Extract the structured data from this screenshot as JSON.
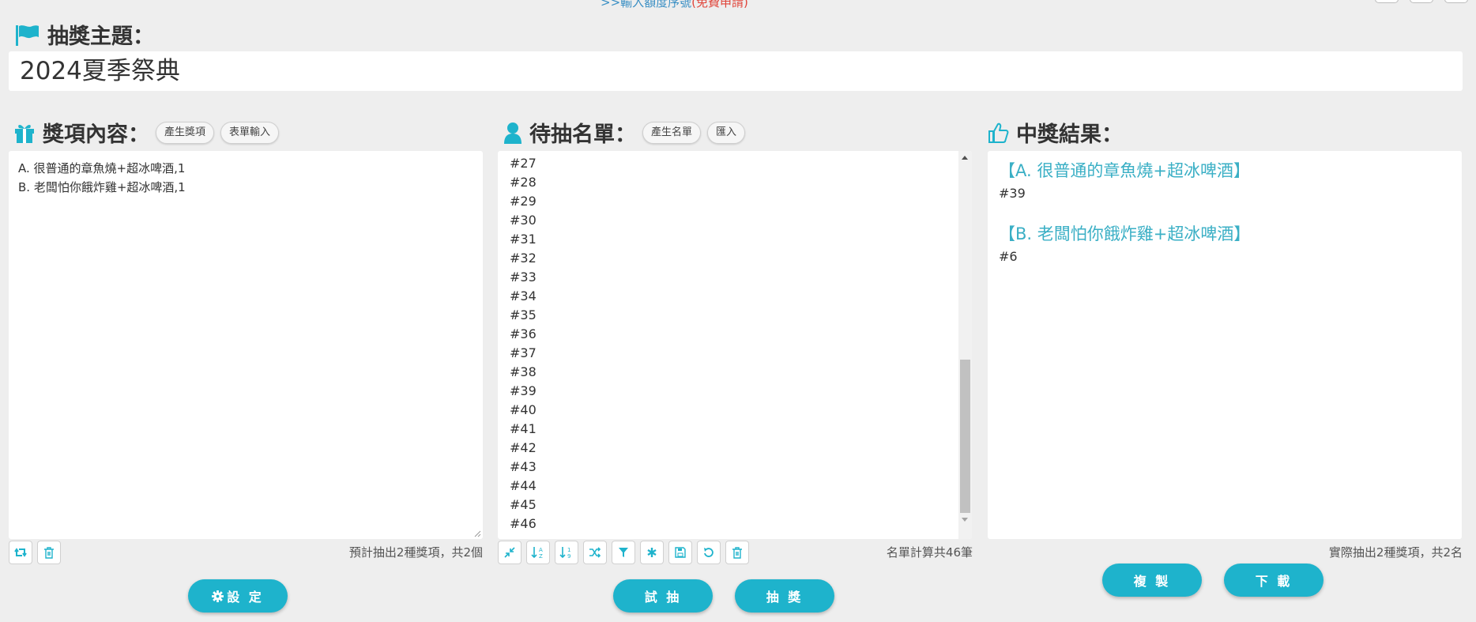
{
  "top": {
    "link_text": ">>輸入額度序號",
    "link_note": "(免費申請)"
  },
  "topic": {
    "label": "抽獎主題：",
    "value": "2024夏季祭典"
  },
  "prizes": {
    "heading": "獎項內容：",
    "generate_button": "產生獎項",
    "form_input_button": "表單輸入",
    "lines": [
      "A. 很普通的章魚燒+超冰啤酒,1",
      "B. 老闆怕你餓炸雞+超冰啤酒,1"
    ],
    "status": "預計抽出2種獎項，共2個",
    "set_button": "設 定"
  },
  "entrants": {
    "heading": "待抽名單：",
    "generate_button": "產生名單",
    "import_button": "匯入",
    "visible_items": [
      "#27",
      "#28",
      "#29",
      "#30",
      "#31",
      "#32",
      "#33",
      "#34",
      "#35",
      "#36",
      "#37",
      "#38",
      "#39",
      "#40",
      "#41",
      "#42",
      "#43",
      "#44",
      "#45",
      "#46"
    ],
    "status": "名單計算共46筆",
    "trial_button": "試 抽",
    "draw_button": "抽 獎"
  },
  "results": {
    "heading": "中獎結果：",
    "groups": [
      {
        "prize": "【A. 很普通的章魚燒+超冰啤酒】",
        "winner": "#39"
      },
      {
        "prize": "【B. 老闆怕你餓炸雞+超冰啤酒】",
        "winner": "#6"
      }
    ],
    "status": "實際抽出2種獎項，共2名",
    "copy_button": "複 製",
    "download_button": "下 載"
  },
  "colors": {
    "accent": "#1eb3cc",
    "result_text": "#3aafc5",
    "background": "#eeeeee"
  },
  "icons": {
    "topic": "flag-icon",
    "prizes": "gift-icon",
    "entrants": "user-icon",
    "results": "thumbs-up-icon"
  }
}
